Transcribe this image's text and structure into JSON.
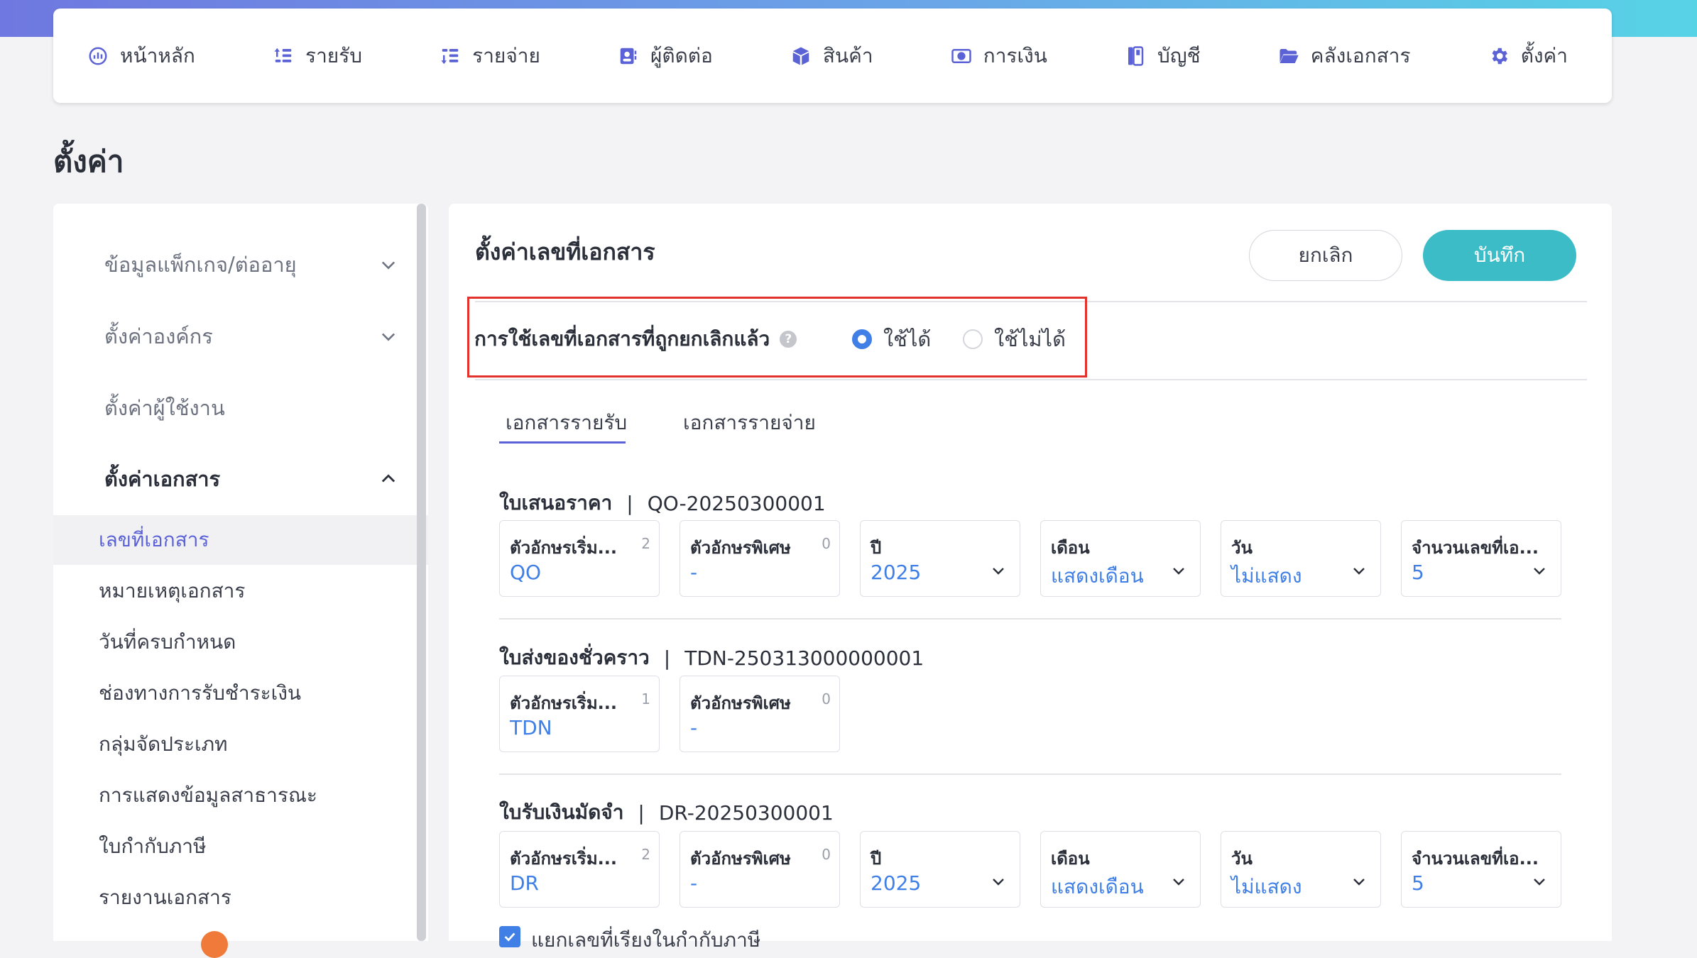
{
  "nav": [
    {
      "label": "หน้าหลัก",
      "icon": "dashboard-icon"
    },
    {
      "label": "รายรับ",
      "icon": "income-icon"
    },
    {
      "label": "รายจ่าย",
      "icon": "expense-icon"
    },
    {
      "label": "ผู้ติดต่อ",
      "icon": "contacts-icon"
    },
    {
      "label": "สินค้า",
      "icon": "product-box-icon"
    },
    {
      "label": "การเงิน",
      "icon": "money-icon"
    },
    {
      "label": "บัญชี",
      "icon": "ledger-book-icon"
    },
    {
      "label": "คลังเอกสาร",
      "icon": "folder-open-icon"
    },
    {
      "label": "ตั้งค่า",
      "icon": "gear-icon"
    }
  ],
  "page_title": "ตั้งค่า",
  "sidebar": {
    "sections": [
      {
        "label": "ข้อมูลแพ็กเกจ/ต่ออายุ"
      },
      {
        "label": "ตั้งค่าองค์กร"
      },
      {
        "label": "ตั้งค่าผู้ใช้งาน"
      },
      {
        "label": "ตั้งค่าเอกสาร"
      }
    ],
    "items": [
      {
        "label": "เลขที่เอกสาร"
      },
      {
        "label": "หมายเหตุเอกสาร"
      },
      {
        "label": "วันที่ครบกำหนด"
      },
      {
        "label": "ช่องทางการรับชำระเงิน"
      },
      {
        "label": "กลุ่มจัดประเภท"
      },
      {
        "label": "การแสดงข้อมูลสาธารณะ"
      },
      {
        "label": "ใบกำกับภาษี"
      },
      {
        "label": "รายงานเอกสาร"
      }
    ]
  },
  "panel": {
    "title": "ตั้งค่าเลขที่เอกสาร",
    "cancel": "ยกเลิก",
    "save": "บันทึก",
    "option_label": "การใช้เลขที่เอกสารที่ถูกยกเลิกแล้ว",
    "radio_yes": "ใช้ได้",
    "radio_no": "ใช้ไม่ได้",
    "tabs": [
      "เอกสารรายรับ",
      "เอกสารรายจ่าย"
    ]
  },
  "documents": [
    {
      "name": "ใบเสนอราคา",
      "code": "QO-20250300001",
      "prefix": {
        "label": "ตัวอักษรเริ่ม...",
        "count": "2",
        "value": "QO"
      },
      "special": {
        "label": "ตัวอักษรพิเศษ",
        "count": "0",
        "value": "-"
      },
      "year": {
        "label": "ปี",
        "value": "2025"
      },
      "month": {
        "label": "เดือน",
        "value": "แสดงเดือน"
      },
      "day": {
        "label": "วัน",
        "value": "ไม่แสดง"
      },
      "digits": {
        "label": "จำนวนเลขที่เอ...",
        "value": "5"
      }
    },
    {
      "name": "ใบส่งของชั่วคราว",
      "code": "TDN-250313000000001",
      "prefix": {
        "label": "ตัวอักษรเริ่ม...",
        "count": "1",
        "value": "TDN"
      },
      "special": {
        "label": "ตัวอักษรพิเศษ",
        "count": "0",
        "value": "-"
      }
    },
    {
      "name": "ใบรับเงินมัดจำ",
      "code": "DR-20250300001",
      "prefix": {
        "label": "ตัวอักษรเริ่ม...",
        "count": "2",
        "value": "DR"
      },
      "special": {
        "label": "ตัวอักษรพิเศษ",
        "count": "0",
        "value": "-"
      },
      "year": {
        "label": "ปี",
        "value": "2025"
      },
      "month": {
        "label": "เดือน",
        "value": "แสดงเดือน"
      },
      "day": {
        "label": "วัน",
        "value": "ไม่แสดง"
      },
      "digits": {
        "label": "จำนวนเลขที่เอ...",
        "value": "5"
      }
    }
  ],
  "checkbox_label": "แยกเลขที่เรียงในกำกับภาษี"
}
